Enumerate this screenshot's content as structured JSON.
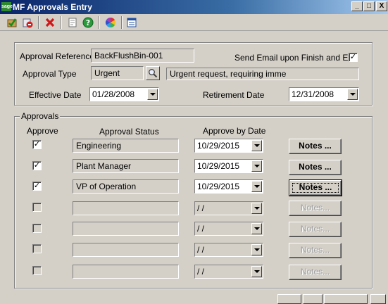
{
  "window": {
    "title": "MF Approvals Entry",
    "app_icon_text": "sage",
    "minimize": "_",
    "maximize": "□",
    "close": "X"
  },
  "toolbar": {
    "icons": [
      "accept-icon",
      "delete-record-icon",
      "cancel-icon",
      "memo-icon",
      "help-icon",
      "color-wheel-icon",
      "settings-icon"
    ]
  },
  "header": {
    "approval_reference_label": "Approval Reference",
    "approval_reference_value": "BackFlushBin-001",
    "send_email_label": "Send Email upon Finish and Exit",
    "send_email_checked": "✓",
    "approval_type_label": "Approval Type",
    "approval_type_value": "Urgent",
    "approval_type_description": "Urgent request, requiring imme",
    "effective_date_label": "Effective Date",
    "effective_date_value": "01/28/2008",
    "retirement_date_label": "Retirement Date",
    "retirement_date_value": "12/31/2008"
  },
  "approvals": {
    "group_label": "Approvals",
    "columns": {
      "approve": "Approve",
      "status": "Approval Status",
      "date": "Approve by Date"
    },
    "rows": [
      {
        "checked": "✓",
        "status": "Engineering",
        "date": "10/29/2015",
        "notes": "Notes ...",
        "enabled": true
      },
      {
        "checked": "✓",
        "status": "Plant Manager",
        "date": "10/29/2015",
        "notes": "Notes ...",
        "enabled": true
      },
      {
        "checked": "✓",
        "status": "VP of Operation",
        "date": "10/29/2015",
        "notes": "Notes ...",
        "enabled": true
      },
      {
        "checked": "",
        "status": "",
        "date": " / /",
        "notes": "Notes...",
        "enabled": false
      },
      {
        "checked": "",
        "status": "",
        "date": " / /",
        "notes": "Notes...",
        "enabled": false
      },
      {
        "checked": "",
        "status": "",
        "date": " / /",
        "notes": "Notes...",
        "enabled": false
      },
      {
        "checked": "",
        "status": "",
        "date": " / /",
        "notes": "Notes...",
        "enabled": false
      }
    ]
  }
}
